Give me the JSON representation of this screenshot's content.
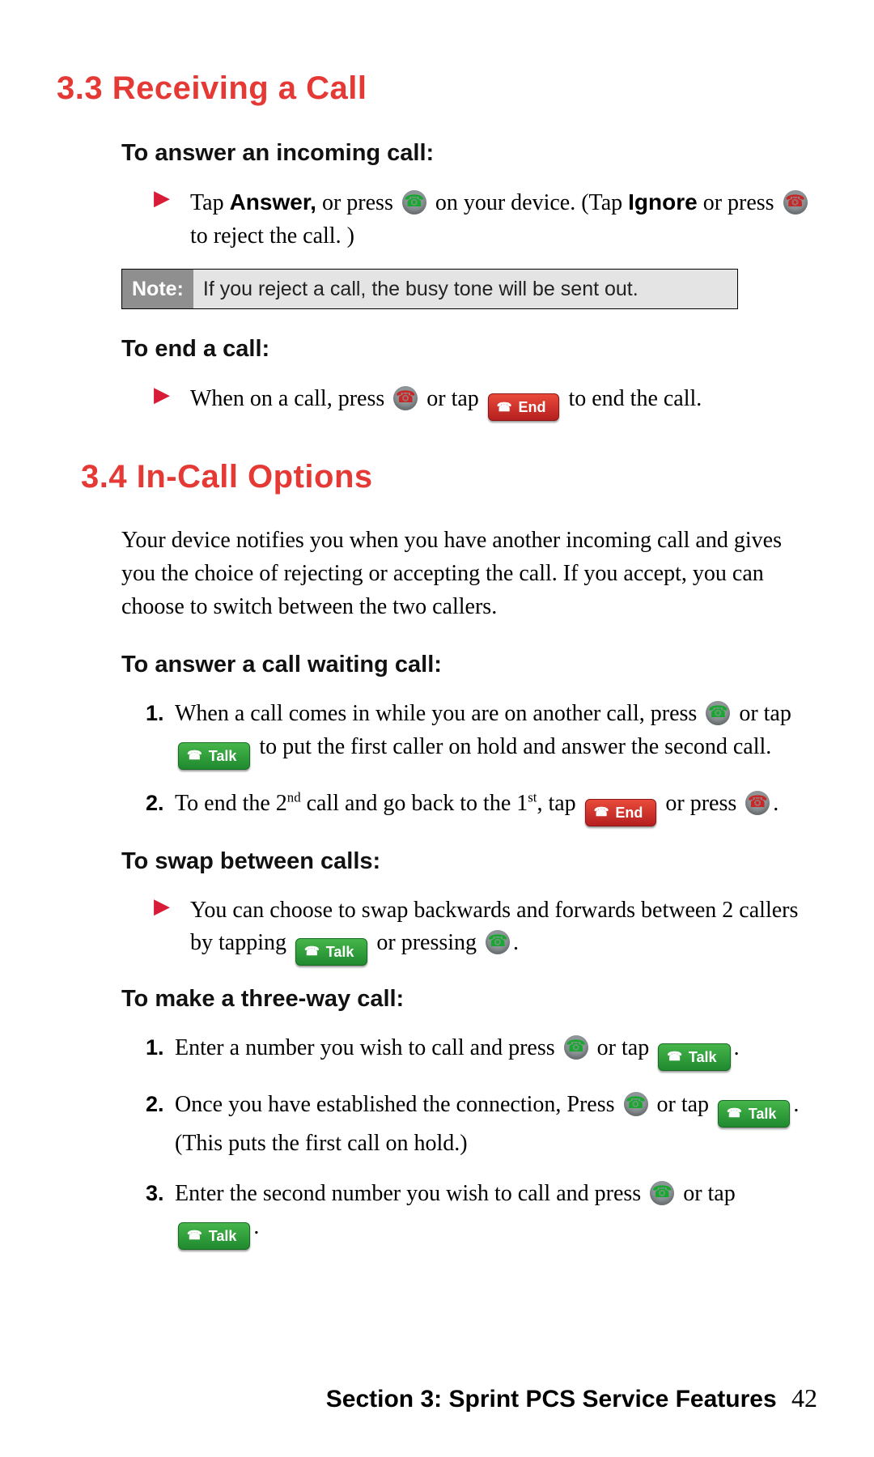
{
  "section33": {
    "heading": "3.3  Receiving a Call",
    "answer_sub": "To answer an incoming call:",
    "answer_bullet_a": "Tap ",
    "answer_word": "Answer,",
    "answer_bullet_b": " or press ",
    "answer_bullet_c": " on your device. (Tap ",
    "ignore_word": "Ignore",
    "answer_bullet_d": " or press ",
    "answer_bullet_e": " to reject the call. )",
    "note_label": "Note:",
    "note_text": "If you reject a call, the busy tone will be sent out.",
    "end_sub": "To end a call:",
    "end_bullet_a": "When on a call, press ",
    "end_bullet_b": " or tap ",
    "end_bullet_c": " to end the call."
  },
  "section34": {
    "heading": "3.4  In-Call Options",
    "intro": "Your device notifies you when you have another incoming call and gives you the choice of rejecting or accepting the call. If you accept, you can choose to switch between the two callers.",
    "waiting_sub": "To answer a call waiting call:",
    "wait1_a": "When a call comes in while you are on another call, press ",
    "wait1_b": " or tap ",
    "wait1_c": " to put the first caller on hold and answer the second call.",
    "wait2_a": "To end the 2",
    "wait2_sup1": "nd",
    "wait2_b": " call and go back to the 1",
    "wait2_sup2": "st",
    "wait2_c": ", tap ",
    "wait2_d": " or press ",
    "swap_sub": "To swap between calls:",
    "swap_a": "You can choose to swap backwards and forwards between 2 callers by tapping ",
    "swap_b": " or pressing ",
    "three_sub": "To make a three-way call:",
    "three1_a": "Enter a number you wish to call and press ",
    "three1_b": " or tap ",
    "three2_a": "Once you have established the connection, Press ",
    "three2_b": " or tap ",
    "three2_c": ". (This puts the first call on hold.)",
    "three3_a": "Enter the second number you wish to call and press ",
    "three3_b": " or tap "
  },
  "buttons": {
    "end": "End",
    "talk": "Talk"
  },
  "markers": {
    "tri": "▶",
    "num": [
      "1.",
      "2.",
      "3."
    ],
    "period": "."
  },
  "footer": {
    "text": "Section 3: Sprint PCS Service Features",
    "page": "42"
  }
}
